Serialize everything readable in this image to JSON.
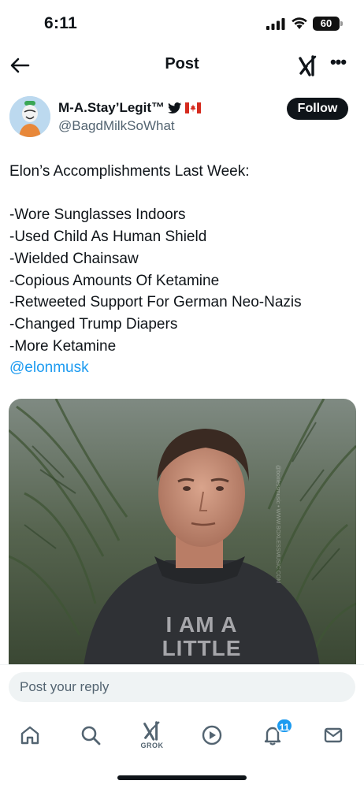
{
  "status_bar": {
    "time": "6:11",
    "battery": "60"
  },
  "header": {
    "title": "Post",
    "back_icon": "arrow-left-icon",
    "grok_icon": "grok-icon",
    "more_icon": "more-horizontal-icon",
    "more_label": "•••"
  },
  "author": {
    "name": "M-A.Stay’Legit™",
    "handle": "@BagdMilkSoWhat",
    "follow_label": "Follow",
    "badges": [
      "twitter-bird-icon",
      "canada-flag-icon"
    ]
  },
  "post": {
    "lines": [
      "Elon’s Accomplishments Last Week:",
      "",
      "-Wore Sunglasses Indoors",
      "-Used Child As Human Shield",
      "-Wielded Chainsaw",
      "-Copious Amounts Of Ketamine",
      "-Retweeted Support For German Neo-Nazis",
      "-Changed Trump Diapers",
      "-More Ketamine"
    ],
    "mention": "@elonmusk",
    "image_shirt_text": [
      "I AM A",
      "LITTLE"
    ],
    "image_watermark": "@boxlessmusic • WWW.BOXLESSMUSIC.COM"
  },
  "reply": {
    "placeholder": "Post your reply"
  },
  "tabbar": {
    "items": [
      "home-icon",
      "search-icon",
      "grok-icon",
      "play-icon",
      "notifications-icon",
      "messages-icon"
    ],
    "grok_label": "GROK",
    "notification_count": "11"
  },
  "colors": {
    "accent": "#1d9bf0",
    "text": "#0f1419",
    "secondary": "#536471",
    "input_bg": "#eff3f4"
  }
}
